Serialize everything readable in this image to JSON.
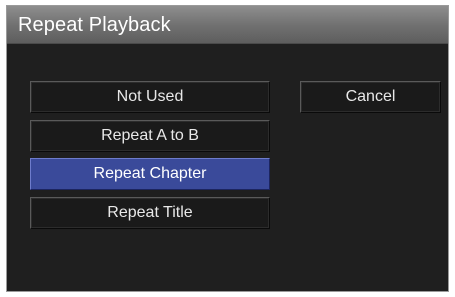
{
  "dialog": {
    "title": "Repeat Playback"
  },
  "options": [
    {
      "label": "Not Used",
      "selected": false
    },
    {
      "label": "Repeat A to B",
      "selected": false
    },
    {
      "label": "Repeat Chapter",
      "selected": true
    },
    {
      "label": "Repeat Title",
      "selected": false
    }
  ],
  "cancel_label": "Cancel",
  "colors": {
    "selected": "#3a4a9a",
    "background": "#1f1f1f",
    "titlebar": "#7a7a7a"
  }
}
